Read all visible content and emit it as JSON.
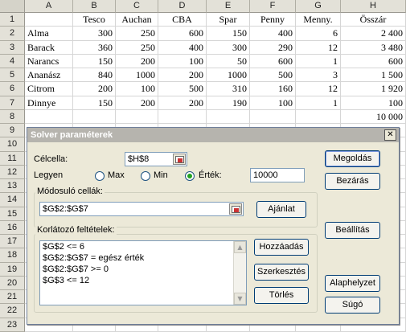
{
  "sheet": {
    "columns": [
      "A",
      "B",
      "C",
      "D",
      "E",
      "F",
      "G",
      "H"
    ],
    "rows": [
      "1",
      "2",
      "3",
      "4",
      "5",
      "6",
      "7",
      "8",
      "9",
      "10",
      "11",
      "12",
      "13",
      "14",
      "15",
      "16",
      "17",
      "18",
      "19",
      "20",
      "21",
      "22",
      "23"
    ],
    "header_row": [
      "",
      "Tesco",
      "Auchan",
      "CBA",
      "Spar",
      "Penny",
      "Menny.",
      "Összár"
    ],
    "data": [
      [
        "Alma",
        "300",
        "250",
        "600",
        "150",
        "400",
        "6",
        "2 400"
      ],
      [
        "Barack",
        "360",
        "250",
        "400",
        "300",
        "290",
        "12",
        "3 480"
      ],
      [
        "Narancs",
        "150",
        "200",
        "100",
        "50",
        "600",
        "1",
        "600"
      ],
      [
        "Ananász",
        "840",
        "1000",
        "200",
        "1000",
        "500",
        "3",
        "1 500"
      ],
      [
        "Citrom",
        "200",
        "100",
        "500",
        "310",
        "160",
        "12",
        "1 920"
      ],
      [
        "Dinnye",
        "150",
        "200",
        "200",
        "190",
        "100",
        "1",
        "100"
      ]
    ],
    "h8": "10 000"
  },
  "dialog": {
    "title": "Solver paraméterek",
    "close": "✕",
    "target_label": "Célcella:",
    "target_value": "$H$8",
    "equal_label": "Legyen",
    "radio_max": "Max",
    "radio_min": "Min",
    "radio_value": "Érték:",
    "selected_radio": "value",
    "value_input": "10000",
    "changing_label": "Módosuló cellák:",
    "changing_value": "$G$2:$G$7",
    "constraints_label": "Korlátozó feltételek:",
    "constraints": [
      "$G$2 <= 6",
      "$G$2:$G$7 = egész érték",
      "$G$2:$G$7 >= 0",
      "$G$3 <= 12"
    ],
    "buttons": {
      "solve": "Megoldás",
      "close": "Bezárás",
      "guess": "Ajánlat",
      "options": "Beállítás",
      "add": "Hozzáadás",
      "change": "Szerkesztés",
      "delete": "Törlés",
      "reset": "Alaphelyzet",
      "help": "Súgó"
    }
  }
}
